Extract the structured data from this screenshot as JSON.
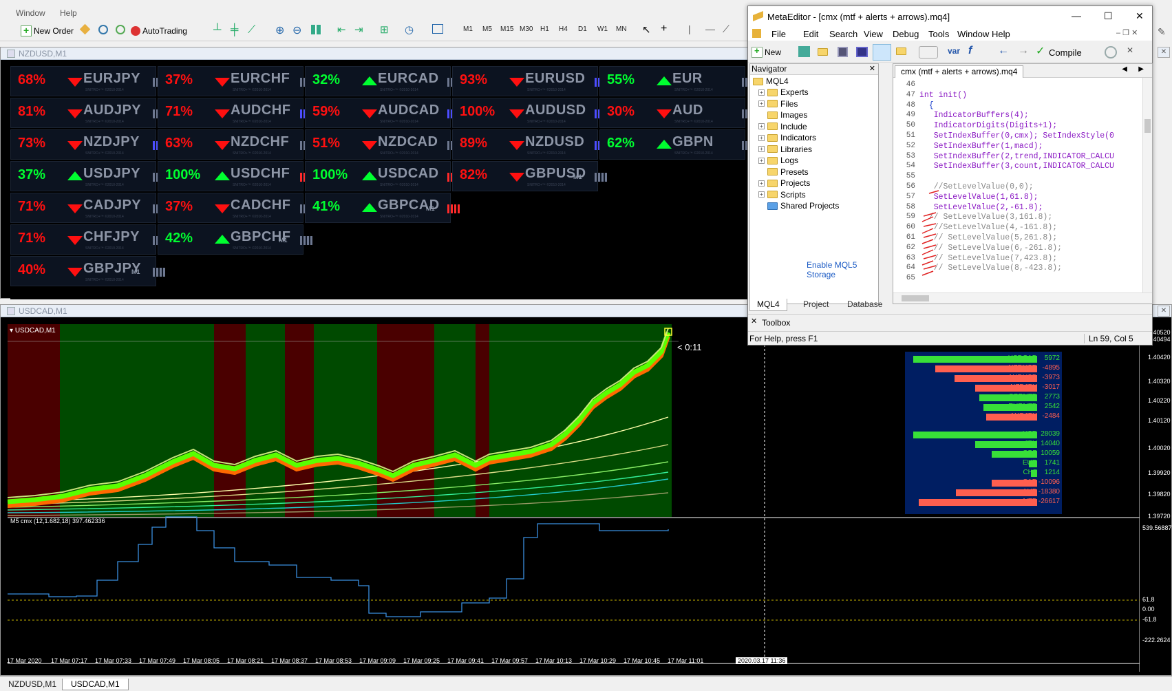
{
  "mt_menu": {
    "window": "Window",
    "help": "Help"
  },
  "mt_toolbar": {
    "new_order": "New Order",
    "auto_trading": "AutoTrading",
    "timeframes": [
      "M1",
      "M5",
      "M15",
      "M30",
      "H1",
      "H4",
      "D1",
      "W1",
      "MN"
    ]
  },
  "nz_window": {
    "title": "NZDUSD,M1",
    "tiles": [
      {
        "pct": "68%",
        "dir": "down",
        "pair": "EURJPY",
        "grid": "n"
      },
      {
        "pct": "37%",
        "dir": "down",
        "pair": "EURCHF",
        "grid": "n"
      },
      {
        "pct": "32%",
        "dir": "up",
        "pair": "EURCAD",
        "grid": "n"
      },
      {
        "pct": "93%",
        "dir": "down",
        "pair": "EURUSD",
        "grid": "h"
      },
      {
        "pct": "55%",
        "dir": "up",
        "pair": "EUR",
        "grid": "n"
      },
      {
        "pct": "81%",
        "dir": "down",
        "pair": "AUDJPY",
        "grid": "n"
      },
      {
        "pct": "71%",
        "dir": "down",
        "pair": "AUDCHF",
        "grid": "h"
      },
      {
        "pct": "59%",
        "dir": "down",
        "pair": "AUDCAD",
        "grid": "h"
      },
      {
        "pct": "100%",
        "dir": "down",
        "pair": "AUDUSD",
        "grid": "h"
      },
      {
        "pct": "30%",
        "dir": "down",
        "pair": "AUD",
        "grid": "n"
      },
      {
        "pct": "73%",
        "dir": "down",
        "pair": "NZDJPY",
        "grid": "h"
      },
      {
        "pct": "63%",
        "dir": "down",
        "pair": "NZDCHF",
        "grid": "n"
      },
      {
        "pct": "51%",
        "dir": "down",
        "pair": "NZDCAD",
        "grid": "n"
      },
      {
        "pct": "89%",
        "dir": "down",
        "pair": "NZDUSD",
        "grid": "h"
      },
      {
        "pct": "62%",
        "dir": "up",
        "pair": "GBPN",
        "grid": "n"
      },
      {
        "pct": "37%",
        "dir": "up",
        "pair": "USDJPY",
        "grid": "n"
      },
      {
        "pct": "100%",
        "dir": "up",
        "pair": "USDCHF",
        "grid": "r"
      },
      {
        "pct": "100%",
        "dir": "up",
        "pair": "USDCAD",
        "grid": "r"
      },
      {
        "pct": "82%",
        "dir": "down",
        "pair": "GBPUSD",
        "grid": "n"
      },
      {
        "pct": "71%",
        "dir": "down",
        "pair": "CADJPY",
        "grid": "n"
      },
      {
        "pct": "37%",
        "dir": "down",
        "pair": "CADCHF",
        "grid": "n"
      },
      {
        "pct": "41%",
        "dir": "up",
        "pair": "GBPCAD",
        "grid": "r"
      },
      {
        "pct": "71%",
        "dir": "down",
        "pair": "CHFJPY",
        "grid": "n"
      },
      {
        "pct": "42%",
        "dir": "up",
        "pair": "GBPCHF",
        "grid": "n"
      },
      {
        "pct": "40%",
        "dir": "down",
        "pair": "GBPJPY",
        "grid": "n"
      }
    ],
    "tile_sub": "SNITRO+™ ©2010-2014",
    "m1_label": "M1"
  },
  "us_window": {
    "title": "USDCAD,M1",
    "chart_label": "USDCAD,M1",
    "timer": "< 0:11",
    "indicator_label": "M5 cmx (12,1.682,18) 397.462336",
    "price_axis": [
      "1.40520",
      "1.40494",
      "1.40420",
      "1.40320",
      "1.40220",
      "1.40120",
      "1.40020",
      "1.39920",
      "1.39820",
      "1.39720"
    ],
    "ind_axis": [
      "539.56887",
      "61.8",
      "0.00",
      "-61.8",
      "-222.2624"
    ],
    "time_axis": [
      "17 Mar 2020",
      "17 Mar 07:17",
      "17 Mar 07:33",
      "17 Mar 07:49",
      "17 Mar 08:05",
      "17 Mar 08:21",
      "17 Mar 08:37",
      "17 Mar 08:53",
      "17 Mar 09:09",
      "17 Mar 09:25",
      "17 Mar 09:41",
      "17 Mar 09:57",
      "17 Mar 10:13",
      "17 Mar 10:29",
      "17 Mar 10:45",
      "17 Mar 11:01"
    ],
    "cursor_time": "2020.03.17 11:36",
    "strength_pairs": [
      {
        "name": "USDCAD",
        "value": "5972",
        "color": "#38e038",
        "len": 180
      },
      {
        "name": "NZDUSD",
        "value": "-4895",
        "color": "#ff5f4f",
        "len": 148
      },
      {
        "name": "AUDUSD",
        "value": "-3973",
        "color": "#ff5f4f",
        "len": 120
      },
      {
        "name": "NZDJPY",
        "value": "-3017",
        "color": "#ff5f4f",
        "len": 90
      },
      {
        "name": "GBPNZD",
        "value": "2773",
        "color": "#38e038",
        "len": 84
      },
      {
        "name": "EURNZD",
        "value": "2542",
        "color": "#38e038",
        "len": 78
      },
      {
        "name": "AUDJPY",
        "value": "-2484",
        "color": "#ff5f4f",
        "len": 74
      }
    ],
    "strength_ccy": [
      {
        "name": "USD",
        "value": "28039",
        "color": "#38e038",
        "len": 180
      },
      {
        "name": "JPY",
        "value": "14040",
        "color": "#38e038",
        "len": 90
      },
      {
        "name": "GBP",
        "value": "10059",
        "color": "#38e038",
        "len": 66
      },
      {
        "name": "EUR",
        "value": "1741",
        "color": "#38e038",
        "len": 12
      },
      {
        "name": "CHF",
        "value": "1214",
        "color": "#38e038",
        "len": 9
      },
      {
        "name": "CAD",
        "value": "-10096",
        "color": "#ff5f4f",
        "len": 66
      },
      {
        "name": "AUD",
        "value": "-18380",
        "color": "#ff5f4f",
        "len": 118
      },
      {
        "name": "NZD",
        "value": "-26617",
        "color": "#ff5f4f",
        "len": 172
      }
    ]
  },
  "bottom_tabs": [
    "NZDUSD,M1",
    "USDCAD,M1"
  ],
  "me": {
    "title": "MetaEditor - [cmx (mtf + alerts + arrows).mq4]",
    "menu": [
      "File",
      "Edit",
      "Search",
      "View",
      "Debug",
      "Tools",
      "Window",
      "Help"
    ],
    "tb_new": "New",
    "tb_compile": "Compile",
    "tb_var": "var",
    "navigator_title": "Navigator",
    "nav_root": "MQL4",
    "nav_items": [
      "Experts",
      "Files",
      "Images",
      "Include",
      "Indicators",
      "Libraries",
      "Logs",
      "Presets",
      "Projects",
      "Scripts",
      "Shared Projects"
    ],
    "enable_storage": "Enable MQL5 Storage",
    "nav_tabs": [
      "MQL4",
      "Project",
      "Database"
    ],
    "file_tab": "cmx (mtf + alerts + arrows).mq4",
    "code": [
      {
        "n": "46",
        "t": ""
      },
      {
        "n": "47",
        "t": "int init()"
      },
      {
        "n": "48",
        "t": "  {"
      },
      {
        "n": "49",
        "t": "   IndicatorBuffers(4);"
      },
      {
        "n": "50",
        "t": "   IndicatorDigits(Digits+1);"
      },
      {
        "n": "51",
        "t": "   SetIndexBuffer(0,cmx); SetIndexStyle(0"
      },
      {
        "n": "52",
        "t": "   SetIndexBuffer(1,macd);"
      },
      {
        "n": "53",
        "t": "   SetIndexBuffer(2,trend,INDICATOR_CALCU"
      },
      {
        "n": "54",
        "t": "   SetIndexBuffer(3,count,INDICATOR_CALCU"
      },
      {
        "n": "55",
        "t": ""
      },
      {
        "n": "56",
        "t": "   //SetLevelValue(0,0);"
      },
      {
        "n": "57",
        "t": "   SetLevelValue(1,61.8);"
      },
      {
        "n": "58",
        "t": "   SetLevelValue(2,-61.8);"
      },
      {
        "n": "59",
        "t": "  // SetLevelValue(3,161.8);"
      },
      {
        "n": "60",
        "t": "   //SetLevelValue(4,-161.8);"
      },
      {
        "n": "61",
        "t": "   // SetLevelValue(5,261.8);"
      },
      {
        "n": "62",
        "t": "   // SetLevelValue(6,-261.8);"
      },
      {
        "n": "63",
        "t": "   // SetLevelValue(7,423.8);"
      },
      {
        "n": "64",
        "t": "   // SetLevelValue(8,-423.8);"
      },
      {
        "n": "65",
        "t": ""
      }
    ],
    "toolbox": "Toolbox",
    "status_help": "For Help, press F1",
    "status_pos": "Ln 59, Col 5"
  }
}
